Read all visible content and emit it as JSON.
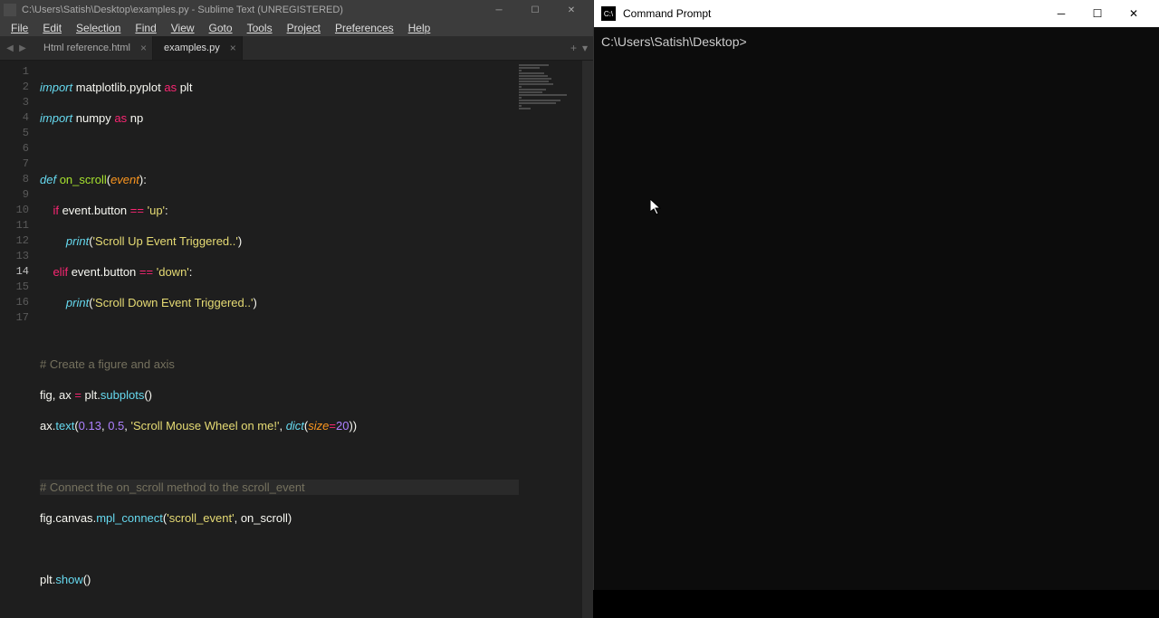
{
  "sublime": {
    "title": "C:\\Users\\Satish\\Desktop\\examples.py - Sublime Text (UNREGISTERED)",
    "menus": [
      "File",
      "Edit",
      "Selection",
      "Find",
      "View",
      "Goto",
      "Tools",
      "Project",
      "Preferences",
      "Help"
    ],
    "tabs": [
      {
        "label": "Html reference.html",
        "active": false
      },
      {
        "label": "examples.py",
        "active": true
      }
    ],
    "active_line": 14,
    "code": {
      "l1": {
        "import": "import",
        "mod": "matplotlib",
        "dot": ".",
        "sub": "pyplot",
        "as": "as",
        "alias": "plt"
      },
      "l2": {
        "import": "import",
        "mod": "numpy",
        "as": "as",
        "alias": "np"
      },
      "l4": {
        "def": "def",
        "name": "on_scroll",
        "param": "event"
      },
      "l5": {
        "if": "if",
        "var": "event",
        "attr": "button",
        "eq": "==",
        "str": "'up'"
      },
      "l6": {
        "print": "print",
        "str": "'Scroll Up Event Triggered..'"
      },
      "l7": {
        "elif": "elif",
        "var": "event",
        "attr": "button",
        "eq": "==",
        "str": "'down'"
      },
      "l8": {
        "print": "print",
        "str": "'Scroll Down Event Triggered..'"
      },
      "l10": {
        "comment": "# Create a figure and axis"
      },
      "l11": {
        "fig": "fig",
        "ax": "ax",
        "eq": "=",
        "plt": "plt",
        "sub": "subplots"
      },
      "l12": {
        "ax": "ax",
        "text": "text",
        "n1": "0.13",
        "n2": "0.5",
        "str": "'Scroll Mouse Wheel on me!'",
        "dict": "dict",
        "size": "size",
        "eq2": "=",
        "n3": "20"
      },
      "l14": {
        "comment": "# Connect the on_scroll method to the scroll_event"
      },
      "l15": {
        "fig": "fig",
        "canvas": "canvas",
        "mpl": "mpl_connect",
        "str": "'scroll_event'",
        "on": "on_scroll"
      },
      "l17": {
        "plt": "plt",
        "show": "show"
      }
    }
  },
  "cmd": {
    "title": "Command Prompt",
    "prompt": "C:\\Users\\Satish\\Desktop>"
  }
}
